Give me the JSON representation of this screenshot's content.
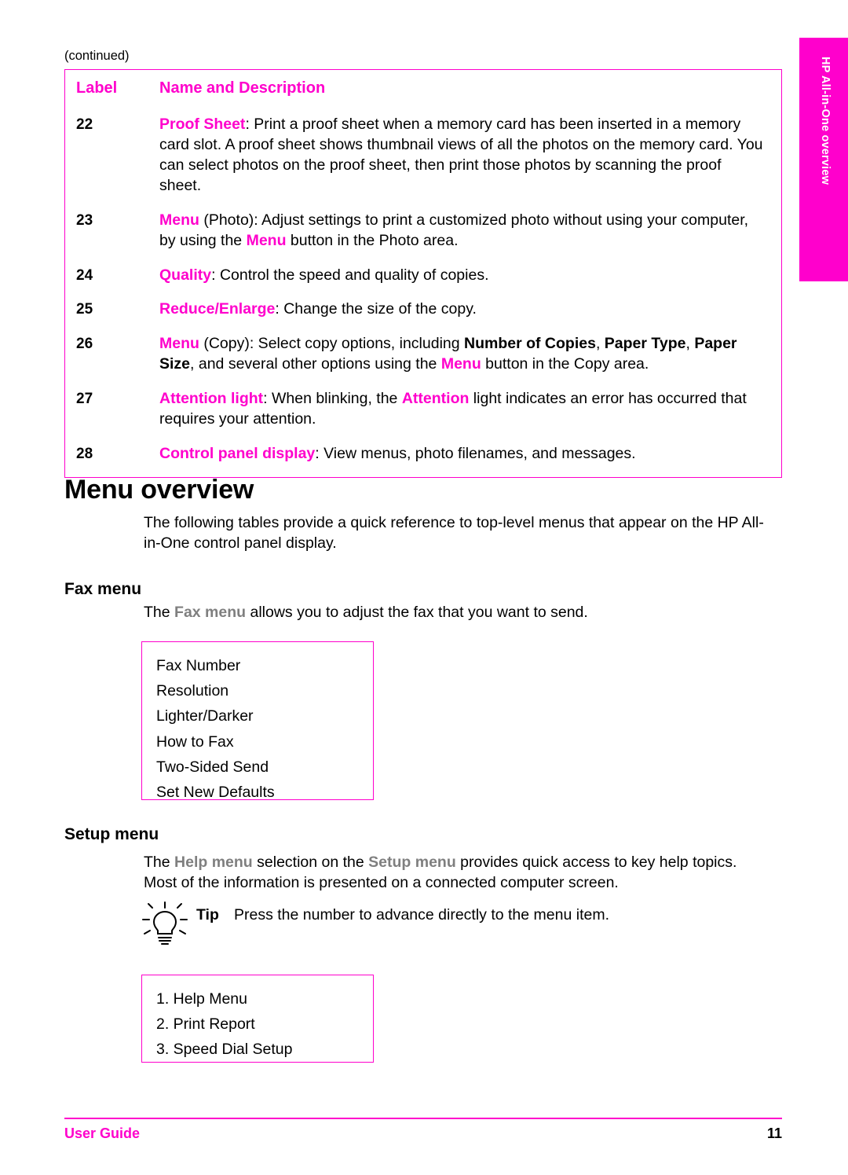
{
  "side_tab": {
    "text": "HP All-in-One overview",
    "color": "#ff00cc"
  },
  "continued_label": "(continued)",
  "table": {
    "headers": {
      "label": "Label",
      "description": "Name and Description"
    },
    "rows": [
      {
        "num": "22",
        "term": "Proof Sheet",
        "text": ": Print a proof sheet when a memory card has been inserted in a memory card slot. A proof sheet shows thumbnail views of all the photos on the memory card. You can select photos on the proof sheet, then print those photos by scanning the proof sheet."
      },
      {
        "num": "23",
        "term": "Menu",
        "text": " (Photo): Adjust settings to print a customized photo without using your computer, by using the "
      },
      {
        "num": "24",
        "term": "Quality",
        "text": ": Control the speed and quality of copies."
      },
      {
        "num": "25",
        "term": "Reduce/Enlarge",
        "text": ": Change the size of the copy."
      },
      {
        "num": "26",
        "term": "Menu",
        "text": " (Copy): Select copy options, including "
      },
      {
        "num": "27",
        "term": "Attention light",
        "text": ": When blinking, the "
      },
      {
        "num": "28",
        "term": "Control panel display",
        "text": ": View menus, photo filenames, and messages."
      }
    ],
    "row23_tail_a": " button in the Photo area.",
    "row23_menu_inline": "Menu",
    "row26_bold_1": "Number of Copies",
    "row26_mid_1": ", ",
    "row26_bold_2": "Paper Type",
    "row26_mid_2": ", ",
    "row26_bold_3": "Paper Size",
    "row26_mid_3": ", and several other options using the ",
    "row26_menu_inline": "Menu",
    "row26_tail": " button in the Copy area.",
    "row27_attention_inline": "Attention",
    "row27_tail": " light indicates an error has occurred that requires your attention."
  },
  "menu_overview": {
    "heading": "Menu overview",
    "intro": "The following tables provide a quick reference to top-level menus that appear on the HP All-in-One control panel display."
  },
  "fax": {
    "heading": "Fax menu",
    "intro_pre": "The ",
    "intro_term": "Fax menu",
    "intro_post": " allows you to adjust the fax that you want to send.",
    "items": [
      "Fax Number",
      "Resolution",
      "Lighter/Darker",
      "How to Fax",
      "Two-Sided Send",
      "Set New Defaults"
    ]
  },
  "setup": {
    "heading": "Setup menu",
    "intro_pre": "The ",
    "intro_term1": "Help menu",
    "intro_mid": " selection on the ",
    "intro_term2": "Setup menu",
    "intro_post": " provides quick access to key help topics. Most of the information is presented on a connected computer screen.",
    "tip_label": "Tip",
    "tip_text": "Press the number to advance directly to the menu item.",
    "tip_icon_name": "lightbulb-icon",
    "items": [
      "1. Help Menu",
      "2. Print Report",
      "3. Speed Dial Setup"
    ]
  },
  "footer": {
    "left": "User Guide",
    "page": "11"
  }
}
